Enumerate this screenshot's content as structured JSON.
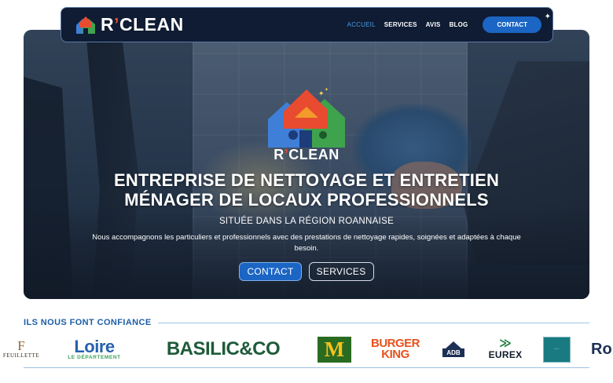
{
  "brand": {
    "name_left": "R",
    "apostrophe": "’",
    "name_right": "CLEAN"
  },
  "nav": {
    "links": [
      "ACCUEIL",
      "SERVICES",
      "AVIS",
      "BLOG"
    ],
    "active": "ACCUEIL",
    "cta": "CONTACT"
  },
  "hero": {
    "logo_text_left": "R",
    "logo_apostrophe": "’",
    "logo_text_right": "CLEAN",
    "title_line1": "ENTREPRISE DE NETTOYAGE ET ENTRETIEN",
    "title_line2": "MÉNAGER DE LOCAUX PROFESSIONNELS",
    "subtitle": "SITUÉE DANS LA RÉGION ROANNAISE",
    "description": "Nous accompagnons les particuliers et professionnels avec des prestations de nettoyage rapides, soignées et adaptées à chaque besoin.",
    "primary_button": "CONTACT",
    "secondary_button": "SERVICES"
  },
  "partners": {
    "heading": "ILS NOUS FONT CONFIANCE",
    "logos": {
      "feuillette_mono": "F",
      "feuillette": "FEUILLETTE",
      "loire_main": "Loire",
      "loire_sub": "LE DÉPARTEMENT",
      "basilic": "BASILIC&CO",
      "mcdonalds": "M",
      "bk_line1": "BURGER",
      "bk_line2": "KING",
      "adb": "ADB",
      "eurex": "EUREX",
      "ro": "Ro"
    }
  },
  "colors": {
    "navy": "#0f1c33",
    "accent_blue": "#1b65c4",
    "active_link": "#4a9be8",
    "heading_blue": "#1b5ea8",
    "apostrophe_red": "#e84b2f"
  }
}
